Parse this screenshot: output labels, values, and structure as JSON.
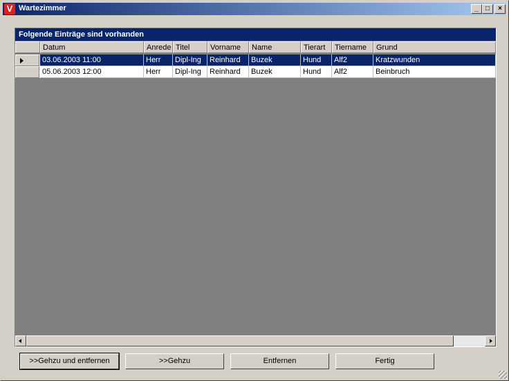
{
  "window": {
    "title": "Wartezimmer",
    "icon_letter": "V"
  },
  "titlebar_buttons": {
    "minimize": "_",
    "maximize": "□",
    "close": "×"
  },
  "grid": {
    "caption": "Folgende Einträge sind vorhanden",
    "columns": [
      "Datum",
      "Anrede",
      "Titel",
      "Vorname",
      "Name",
      "Tierart",
      "Tiername",
      "Grund"
    ],
    "rows": [
      [
        "03.06.2003 11:00",
        "Herr",
        "Dipl-Ing",
        "Reinhard",
        "Buzek",
        "Hund",
        "Alf2",
        "Kratzwunden"
      ],
      [
        "05.06.2003 12:00",
        "Herr",
        "Dipl-Ing",
        "Reinhard",
        "Buzek",
        "Hund",
        "Alf2",
        "Beinbruch"
      ]
    ],
    "selected_row": 0
  },
  "buttons": {
    "gehzu_entfernen": ">>Gehzu und entfernen",
    "gehzu": ">>Gehzu",
    "entfernen": "Entfernen",
    "fertig": "Fertig"
  }
}
